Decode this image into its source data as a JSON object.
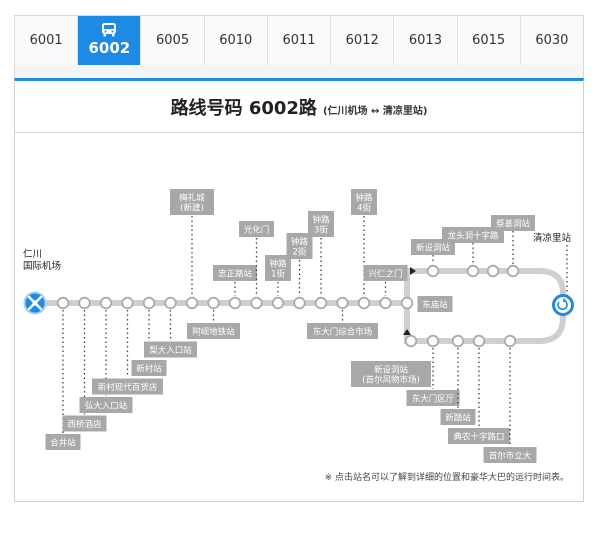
{
  "tabs": [
    {
      "label": "6001",
      "active": false
    },
    {
      "label": "6002",
      "active": true
    },
    {
      "label": "6005",
      "active": false
    },
    {
      "label": "6010",
      "active": false
    },
    {
      "label": "6011",
      "active": false
    },
    {
      "label": "6012",
      "active": false
    },
    {
      "label": "6013",
      "active": false
    },
    {
      "label": "6015",
      "active": false
    },
    {
      "label": "6030",
      "active": false
    }
  ],
  "header": {
    "title": "路线号码 6002路",
    "subtitle": "(仁川机场 ↔ 清凉里站)"
  },
  "terminals": {
    "start": [
      "仁川",
      "国际机场"
    ],
    "end": "清凉里站"
  },
  "stops_main": [
    {
      "label": [
        "合井站"
      ],
      "side": "below",
      "level": 6
    },
    {
      "label": [
        "西桥酒店"
      ],
      "side": "below",
      "level": 5
    },
    {
      "label": [
        "弘大入口站"
      ],
      "side": "below",
      "level": 4
    },
    {
      "label": [
        "新村现代百货店"
      ],
      "side": "below",
      "level": 3
    },
    {
      "label": [
        "新村站"
      ],
      "side": "below",
      "level": 2
    },
    {
      "label": [
        "梨大入口站"
      ],
      "side": "below",
      "level": 1
    },
    {
      "label": [
        "梅礼城",
        "(新建)"
      ],
      "side": "above",
      "level": 3
    },
    {
      "label": [
        "阿岘地铁站"
      ],
      "side": "below",
      "level": 0
    },
    {
      "label": [
        "忠正路站"
      ],
      "side": "above",
      "level": 0
    },
    {
      "label": [
        "光化门"
      ],
      "side": "above",
      "level": 2
    },
    {
      "label": [
        "钟路",
        "1街"
      ],
      "side": "above",
      "level": 0
    },
    {
      "label": [
        "钟路",
        "2街"
      ],
      "side": "above",
      "level": 1
    },
    {
      "label": [
        "钟路",
        "3街"
      ],
      "side": "above",
      "level": 2
    },
    {
      "label": [
        "东大门综合市场"
      ],
      "side": "below",
      "level": 0
    },
    {
      "label": [
        "钟路",
        "4街"
      ],
      "side": "above",
      "level": 3
    },
    {
      "label": [
        "兴仁之门"
      ],
      "side": "above",
      "level": 0
    }
  ],
  "stops_loop_top": [
    {
      "label": [
        "东庙站"
      ]
    },
    {
      "label": [
        "新设洞站"
      ]
    },
    {
      "label": [
        "龙头洞十字路"
      ]
    },
    {
      "label": [
        "祭基洞站"
      ]
    }
  ],
  "stops_loop_bottom": [
    {
      "label": [
        "新设洞站",
        "(首尔风物市场)"
      ]
    },
    {
      "label": [
        "东大门区厅"
      ]
    },
    {
      "label": [
        "新踏站"
      ]
    },
    {
      "label": [
        "典农十字路口"
      ]
    },
    {
      "label": [
        "首尔市立大"
      ]
    }
  ],
  "footer": {
    "note": "※ 点击站名可以了解到详细的位置和豪华大巴的运行时间表。"
  },
  "colors": {
    "accent": "#1d8ae4",
    "route": "#cfcfcf",
    "label_bg": "#a8a8a8"
  }
}
